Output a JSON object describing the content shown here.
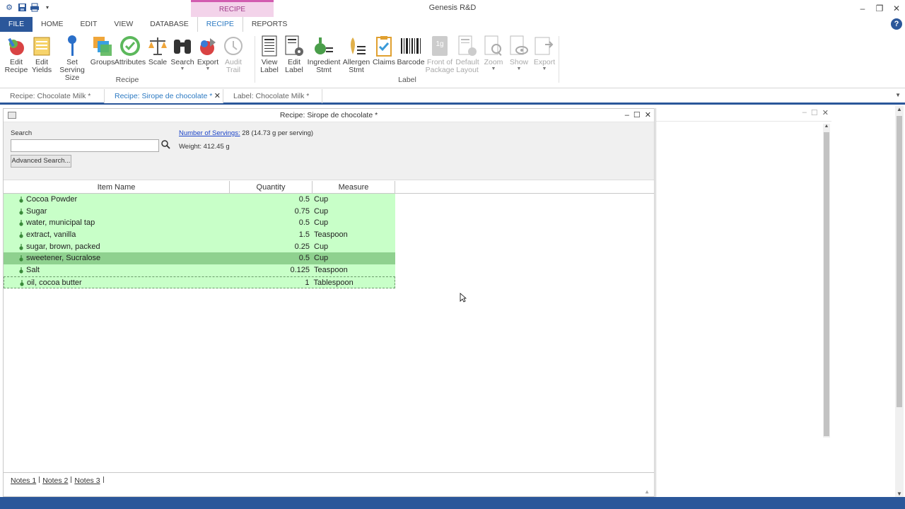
{
  "app": {
    "title": "Genesis R&D",
    "context_tab_header": "RECIPE"
  },
  "ribbon_tabs": [
    "FILE",
    "HOME",
    "EDIT",
    "VIEW",
    "DATABASE",
    "RECIPE",
    "REPORTS"
  ],
  "ribbon": {
    "recipe_group": {
      "label": "Recipe",
      "buttons": [
        {
          "label": "Edit Recipe",
          "icon": "edit-recipe-icon"
        },
        {
          "label": "Edit Yields",
          "icon": "edit-yields-icon"
        },
        {
          "label": "Set Serving Size",
          "icon": "serving-size-icon"
        },
        {
          "label": "Groups",
          "icon": "groups-icon"
        },
        {
          "label": "Attributes",
          "icon": "attributes-icon"
        },
        {
          "label": "Scale",
          "icon": "scale-icon"
        },
        {
          "label": "Search",
          "icon": "binoculars-icon"
        },
        {
          "label": "Export",
          "icon": "export-icon"
        },
        {
          "label": "Audit Trail",
          "icon": "audit-trail-icon"
        }
      ]
    },
    "label_group": {
      "label": "Label",
      "buttons": [
        {
          "label": "View Label",
          "icon": "view-label-icon"
        },
        {
          "label": "Edit Label",
          "icon": "edit-label-icon"
        },
        {
          "label": "Ingredient Stmt",
          "icon": "ingredient-stmt-icon"
        },
        {
          "label": "Allergen Stmt",
          "icon": "allergen-stmt-icon"
        },
        {
          "label": "Claims",
          "icon": "claims-icon"
        },
        {
          "label": "Barcode",
          "icon": "barcode-icon"
        },
        {
          "label": "Front of Package",
          "icon": "front-of-package-icon"
        },
        {
          "label": "Default Layout",
          "icon": "default-layout-icon"
        },
        {
          "label": "Zoom",
          "icon": "zoom-icon"
        },
        {
          "label": "Show",
          "icon": "show-icon"
        },
        {
          "label": "Export",
          "icon": "label-export-icon"
        }
      ]
    }
  },
  "doc_tabs": [
    {
      "label": "Recipe: Chocolate Milk *"
    },
    {
      "label": "Recipe: Sirope de chocolate *"
    },
    {
      "label": "Label: Chocolate Milk *"
    }
  ],
  "recipe_window": {
    "title": "Recipe: Sirope de chocolate *",
    "search_label": "Search",
    "search_value": "",
    "advanced_search": "Advanced Search...",
    "servings_link": "Number of Servings:",
    "servings_value": "28  (14.73 g per serving)",
    "weight": "Weight: 412.45 g"
  },
  "grid": {
    "headers": [
      "Item Name",
      "Quantity",
      "Measure"
    ],
    "rows": [
      {
        "name": "Cocoa Powder",
        "qty": "0.5",
        "measure": "Cup"
      },
      {
        "name": "Sugar",
        "qty": "0.75",
        "measure": "Cup"
      },
      {
        "name": "water, municipal tap",
        "qty": "0.5",
        "measure": "Cup"
      },
      {
        "name": "extract, vanilla",
        "qty": "1.5",
        "measure": "Teaspoon"
      },
      {
        "name": "sugar, brown, packed",
        "qty": "0.25",
        "measure": "Cup"
      },
      {
        "name": "sweetener, Sucralose",
        "qty": "0.5",
        "measure": "Cup"
      },
      {
        "name": "Salt",
        "qty": "0.125",
        "measure": "Teaspoon"
      },
      {
        "name": "oil, cocoa butter",
        "qty": "1",
        "measure": "Tablespoon"
      }
    ]
  },
  "notes_tabs": [
    "Notes 1",
    "Notes 2",
    "Notes 3"
  ],
  "colors": {
    "accent": "#2b579a",
    "row_green": "#c8ffc8",
    "row_selected": "#8fd18f",
    "context_tab": "#f3d3ea"
  }
}
